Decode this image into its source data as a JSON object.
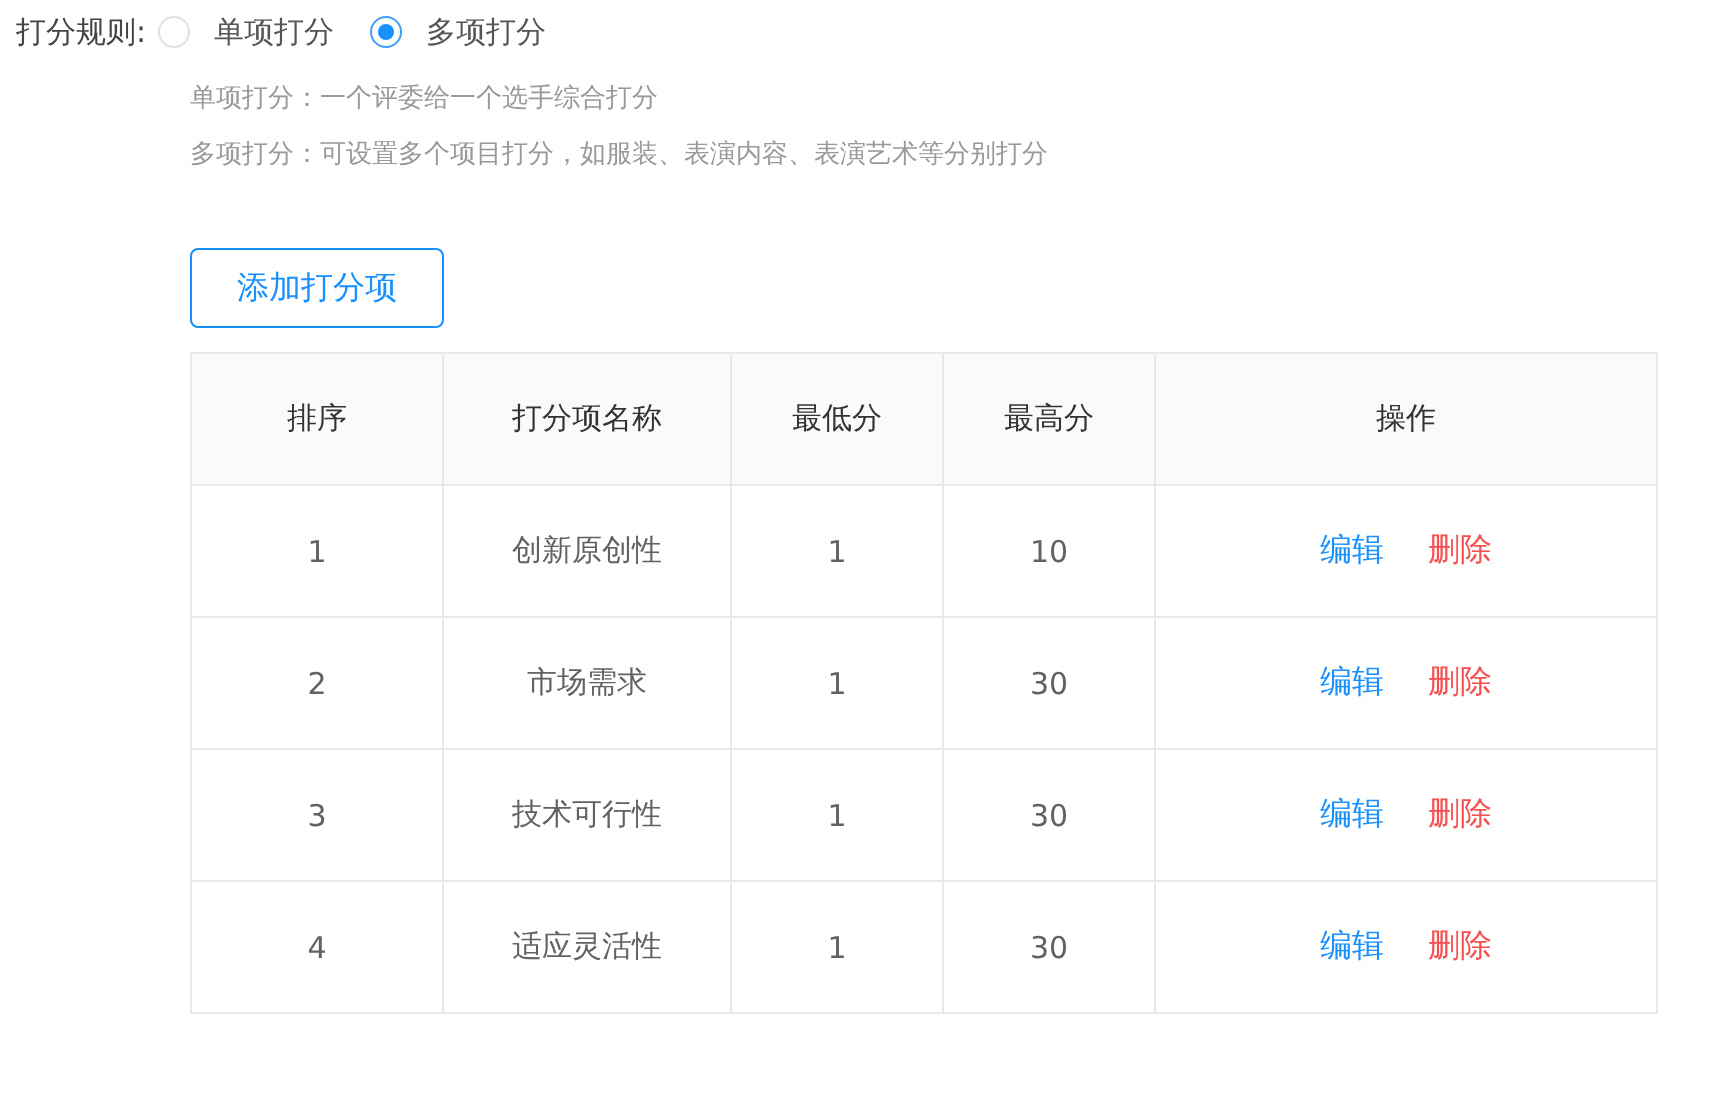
{
  "scoring_rule": {
    "label": "打分规则:",
    "options": [
      {
        "label": "单项打分",
        "selected": false
      },
      {
        "label": "多项打分",
        "selected": true
      }
    ],
    "hints": [
      "单项打分：一个评委给一个选手综合打分",
      "多项打分：可设置多个项目打分，如服装、表演内容、表演艺术等分别打分"
    ]
  },
  "add_button": "添加打分项",
  "table": {
    "columns": [
      "排序",
      "打分项名称",
      "最低分",
      "最高分",
      "操作"
    ],
    "rows": [
      {
        "cells": [
          "1",
          "创新原创性",
          "1",
          "10"
        ],
        "actions": [
          {
            "label": "编辑",
            "kind": "edit"
          },
          {
            "label": "删除",
            "kind": "delete"
          }
        ]
      },
      {
        "cells": [
          "2",
          "市场需求",
          "1",
          "30"
        ],
        "actions": [
          {
            "label": "编辑",
            "kind": "edit"
          },
          {
            "label": "删除",
            "kind": "delete"
          }
        ]
      },
      {
        "cells": [
          "3",
          "技术可行性",
          "1",
          "30"
        ],
        "actions": [
          {
            "label": "编辑",
            "kind": "edit"
          },
          {
            "label": "删除",
            "kind": "delete"
          }
        ]
      },
      {
        "cells": [
          "4",
          "适应灵活性",
          "1",
          "30"
        ],
        "actions": [
          {
            "label": "编辑",
            "kind": "edit"
          },
          {
            "label": "删除",
            "kind": "delete"
          }
        ]
      }
    ]
  }
}
